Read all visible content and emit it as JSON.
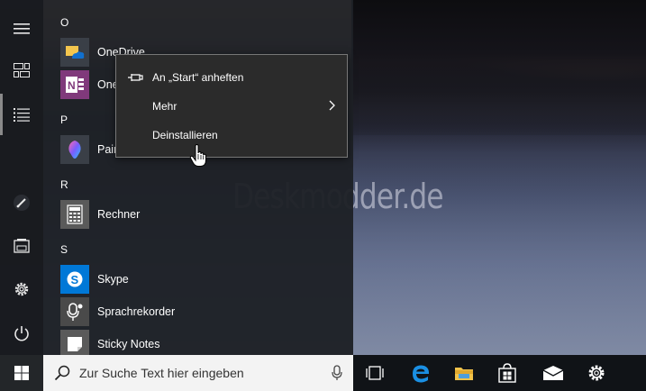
{
  "watermark": "Deskmodder.de",
  "app_list": {
    "sections": [
      {
        "letter": "O",
        "apps": [
          {
            "name": "OneDrive",
            "icon": "onedrive-icon",
            "tile_color": "#3a3f47"
          },
          {
            "name": "One",
            "icon": "onenote-icon",
            "tile_color": "#80397b"
          }
        ]
      },
      {
        "letter": "P",
        "apps": [
          {
            "name": "Pair",
            "icon": "paint3d-icon",
            "tile_color": "#3a3f47"
          }
        ]
      },
      {
        "letter": "R",
        "apps": [
          {
            "name": "Rechner",
            "icon": "calculator-icon",
            "tile_color": "#5a5a5a"
          }
        ]
      },
      {
        "letter": "S",
        "apps": [
          {
            "name": "Skype",
            "icon": "skype-icon",
            "tile_color": "#0078d7"
          },
          {
            "name": "Sprachrekorder",
            "icon": "voice-recorder-icon",
            "tile_color": "#4a4a4a"
          },
          {
            "name": "Sticky Notes",
            "icon": "sticky-notes-icon",
            "tile_color": "#5a5a5a"
          }
        ]
      }
    ]
  },
  "context_menu": {
    "items": [
      {
        "label": "An „Start“ anheften",
        "icon": "pin-icon"
      },
      {
        "label": "Mehr",
        "has_submenu": true
      },
      {
        "label": "Deinstallieren"
      }
    ]
  },
  "rail": {
    "icons": [
      "hamburger-menu-icon",
      "tiles-view-icon",
      "list-view-icon",
      "pen-icon",
      "documents-icon",
      "settings-icon",
      "power-icon"
    ]
  },
  "taskbar": {
    "search_placeholder": "Zur Suche Text hier eingeben",
    "icons": [
      "task-view-icon",
      "edge-icon",
      "file-explorer-icon",
      "store-icon",
      "mail-icon",
      "settings-icon"
    ]
  },
  "colors": {
    "accent": "#0078d7",
    "menu_bg": "#1e2126",
    "taskbar_bg": "#101317",
    "onenote": "#80397b",
    "skype": "#0078d7"
  }
}
